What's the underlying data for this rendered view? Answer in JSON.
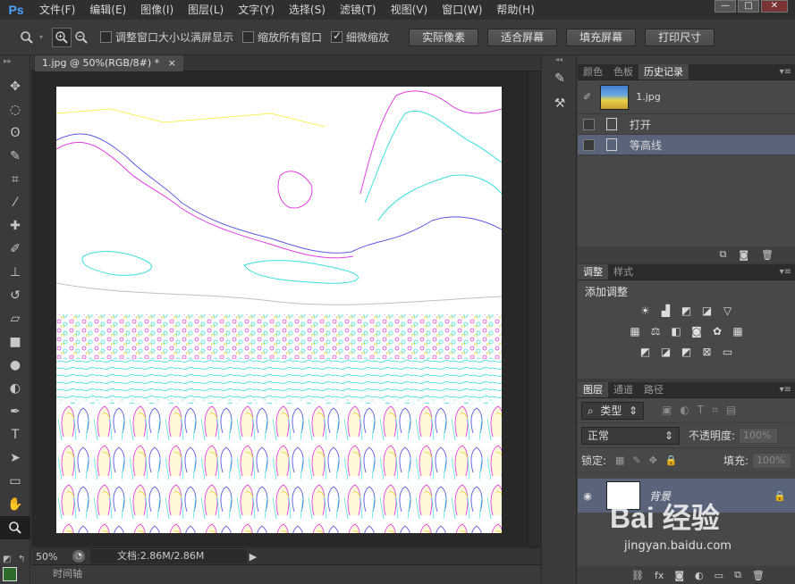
{
  "app": {
    "logo": "Ps"
  },
  "menu": [
    "文件(F)",
    "编辑(E)",
    "图像(I)",
    "图层(L)",
    "文字(Y)",
    "选择(S)",
    "滤镜(T)",
    "视图(V)",
    "窗口(W)",
    "帮助(H)"
  ],
  "window_controls": {
    "minimize": "—",
    "maximize": "□",
    "close": "✕"
  },
  "options": {
    "zoom_tool_icon": "zoom-icon",
    "resize_windows_label": "调整窗口大小以满屏显示",
    "resize_windows_checked": false,
    "zoom_all_label": "缩放所有窗口",
    "zoom_all_checked": false,
    "scrubby_zoom_label": "细微缩放",
    "scrubby_zoom_checked": true,
    "buttons": [
      "实际像素",
      "适合屏幕",
      "填充屏幕",
      "打印尺寸"
    ]
  },
  "document": {
    "tab_title": "1.jpg @ 50%(RGB/8#) *",
    "tab_close": "×",
    "zoom": "50%",
    "doc_info": "文档:2.86M/2.86M",
    "status_arrow": "▶"
  },
  "timeline_label": "时间轴",
  "history_panel": {
    "tabs": [
      "颜色",
      "色板",
      "历史记录"
    ],
    "active_tab": 2,
    "snapshot_name": "1.jpg",
    "states": [
      {
        "label": "打开",
        "selected": false
      },
      {
        "label": "等高线",
        "selected": true
      }
    ]
  },
  "adjust_panel": {
    "tabs": [
      "调整",
      "样式"
    ],
    "active_tab": 0,
    "title": "添加调整"
  },
  "layers_panel": {
    "tabs": [
      "图层",
      "通道",
      "路径"
    ],
    "active_tab": 0,
    "filter_kind": "类型",
    "blend_mode": "正常",
    "opacity_label": "不透明度:",
    "opacity_value": "100%",
    "lock_label": "锁定:",
    "fill_label": "填充:",
    "fill_value": "100%",
    "layers": [
      {
        "name": "背景",
        "visible": true,
        "locked": true
      }
    ]
  },
  "watermark": {
    "brand": "Bai 经验",
    "url": "jingyan.baidu.com"
  }
}
